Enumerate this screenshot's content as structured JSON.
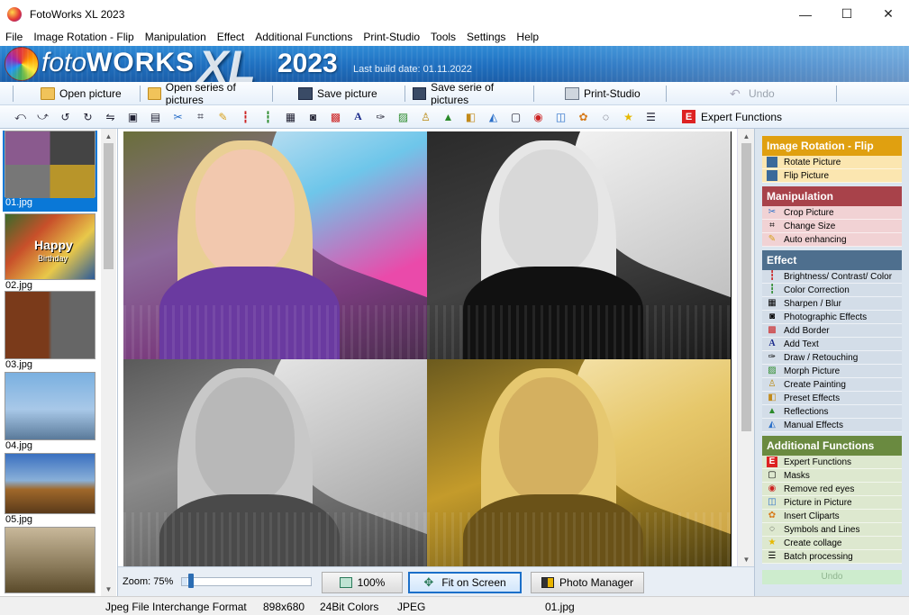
{
  "window": {
    "title": "FotoWorks XL 2023",
    "min_glyph": "—",
    "max_glyph": "☐",
    "close_glyph": "✕"
  },
  "menu": [
    "File",
    "Image Rotation - Flip",
    "Manipulation",
    "Effect",
    "Additional Functions",
    "Print-Studio",
    "Tools",
    "Settings",
    "Help"
  ],
  "banner": {
    "brand_light": "foto",
    "brand_bold": "WORKS",
    "brand_xl": "XL",
    "brand_year": "2023",
    "build_date": "Last build date: 01.11.2022"
  },
  "toolbar": {
    "open_picture": "Open picture",
    "open_series": "Open series of pictures",
    "save_picture": "Save picture",
    "save_series": "Save serie of pictures",
    "print_studio": "Print-Studio",
    "undo": "Undo"
  },
  "tools": [
    "rotate-left-icon",
    "rotate-right-icon",
    "rotate-ccw-icon",
    "rotate-cw-icon",
    "flip-icon",
    "box-icon",
    "film-icon",
    "scissors-icon",
    "crop-icon",
    "wand-icon",
    "levels-icon",
    "color-icon",
    "sharpen-icon",
    "camera-icon",
    "border-icon",
    "text-icon",
    "draw-icon",
    "morph-icon",
    "paint-icon",
    "landscape-icon",
    "preset-icon",
    "reflection-icon",
    "mask-icon",
    "red-eye-icon",
    "pip-icon",
    "clipart-icon",
    "symbol-icon",
    "star-icon",
    "batch-icon"
  ],
  "expert": {
    "badge": "E",
    "label": "Expert Functions"
  },
  "thumbnails": [
    {
      "caption": "01.jpg",
      "selected": true
    },
    {
      "caption": "02.jpg",
      "selected": false
    },
    {
      "caption": "03.jpg",
      "selected": false
    },
    {
      "caption": "04.jpg",
      "selected": false
    },
    {
      "caption": "05.jpg",
      "selected": false
    },
    {
      "caption": "",
      "selected": false
    }
  ],
  "thumb_text": {
    "happy": "Happy",
    "birthday": "Birthday"
  },
  "zoom": {
    "label": "Zoom: 75%",
    "level": 0.75,
    "btn_100": "100%",
    "btn_fit": "Fit on Screen",
    "btn_manager": "Photo Manager"
  },
  "panel": {
    "rotation": {
      "title": "Image Rotation - Flip",
      "color": "#e0a010",
      "items": [
        "Rotate Picture",
        "Flip Picture"
      ]
    },
    "manipulation": {
      "title": "Manipulation",
      "color": "#a8424a",
      "items": [
        "Crop Picture",
        "Change Size",
        "Auto enhancing"
      ]
    },
    "effect": {
      "title": "Effect",
      "color": "#4e6f8e",
      "items": [
        "Brightness/ Contrast/ Color",
        "Color Correction",
        "Sharpen / Blur",
        "Photographic Effects",
        "Add Border",
        "Add Text",
        "Draw / Retouching",
        "Morph Picture",
        "Create Painting",
        "Preset Effects",
        "Reflections",
        "Manual Effects"
      ]
    },
    "additional": {
      "title": "Additional Functions",
      "color": "#6a8a40",
      "items": [
        "Expert Functions",
        "Masks",
        "Remove red eyes",
        "Picture in Picture",
        "Insert Cliparts",
        "Symbols and Lines",
        "Create collage",
        "Batch processing"
      ]
    },
    "undo": "Undo"
  },
  "status": {
    "format": "Jpeg File Interchange Format",
    "size": "898x680",
    "colors": "24Bit Colors",
    "type": "JPEG",
    "file": "01.jpg"
  }
}
